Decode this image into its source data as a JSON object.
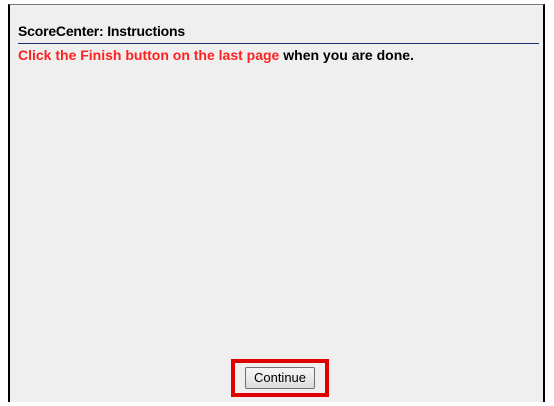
{
  "header": {
    "title": "ScoreCenter: Instructions"
  },
  "instructions": {
    "highlight": "Click the Finish button on the last page",
    "rest": " when you are done."
  },
  "footer": {
    "continue_label": "Continue"
  },
  "colors": {
    "highlight": "#ff2020",
    "frame": "#e00000",
    "rule": "#1a2f6b",
    "panel_bg": "#efefef"
  }
}
